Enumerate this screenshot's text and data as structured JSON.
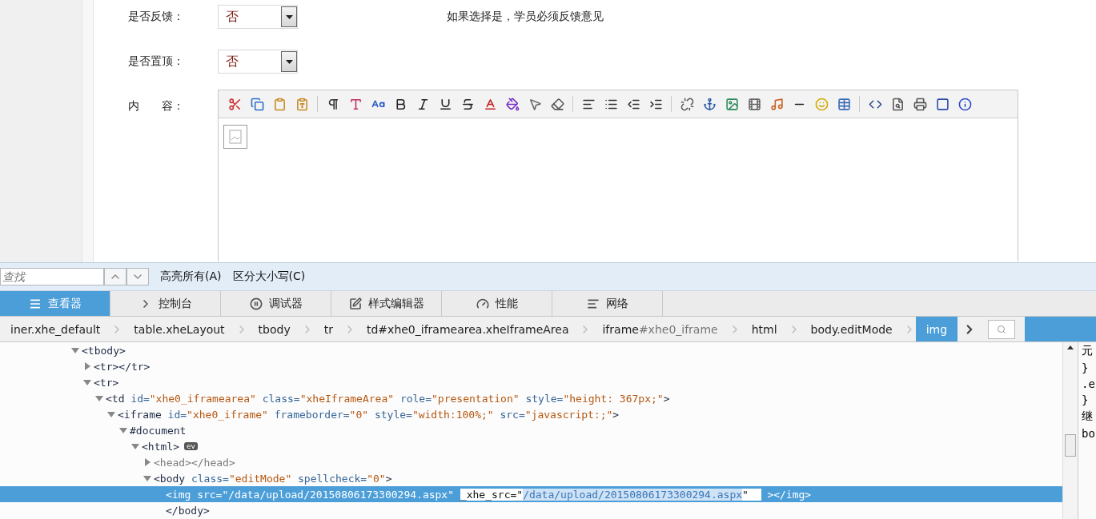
{
  "form": {
    "rows": [
      {
        "kind": "select",
        "label": "是否反馈：",
        "value": "否",
        "hint": "如果选择是，学员必须反馈意见"
      },
      {
        "kind": "select",
        "label": "是否置顶：",
        "value": "否"
      },
      {
        "kind": "editor",
        "label": "内　　容："
      }
    ]
  },
  "devtools": {
    "find_bar": {
      "placeholder": "查找",
      "options": [
        "高亮所有(A)",
        "区分大小写(C)"
      ]
    },
    "tabs": [
      {
        "label": "查看器",
        "selected": true
      },
      {
        "label": "控制台",
        "selected": false
      },
      {
        "label": "调试器",
        "selected": false
      },
      {
        "label": "样式编辑器",
        "selected": false
      },
      {
        "label": "性能",
        "selected": false
      },
      {
        "label": "网络",
        "selected": false
      }
    ],
    "breadcrumbs": [
      {
        "label": "iner.xhe_default",
        "selected": false
      },
      {
        "label": "table.xheLayout",
        "selected": false
      },
      {
        "label": "tbody",
        "selected": false
      },
      {
        "label": "tr",
        "selected": false
      },
      {
        "label": "td#xhe0_iframearea.xheIframeArea",
        "selected": false
      },
      {
        "label": "iframe",
        "suffix": "#xhe0_iframe",
        "selected": false
      },
      {
        "label": "html",
        "selected": false
      },
      {
        "label": "body.editMode",
        "selected": false
      },
      {
        "label": "img",
        "selected": true
      }
    ],
    "tree": [
      {
        "kind": "branch",
        "expanded": true,
        "selected": false,
        "tokens": [
          {
            "kind": "tag",
            "text": "<tbody>"
          }
        ],
        "children": [
          {
            "kind": "branch",
            "expanded": false,
            "selected": false,
            "tokens": [
              {
                "kind": "tag",
                "text": "<tr></tr>"
              }
            ]
          },
          {
            "kind": "branch",
            "expanded": true,
            "selected": false,
            "tokens": [
              {
                "kind": "tag",
                "text": "<tr>"
              }
            ],
            "children": [
              {
                "kind": "branch",
                "expanded": true,
                "selected": false,
                "tokens": [
                  {
                    "kind": "tag",
                    "text": "<td"
                  },
                  {
                    "kind": "attr",
                    "text": " id="
                  },
                  {
                    "kind": "value",
                    "text": "\"xhe0_iframearea\""
                  },
                  {
                    "kind": "attr",
                    "text": " class="
                  },
                  {
                    "kind": "value",
                    "text": "\"xheIframeArea\""
                  },
                  {
                    "kind": "attr",
                    "text": " role="
                  },
                  {
                    "kind": "value",
                    "text": "\"presentation\""
                  },
                  {
                    "kind": "attr",
                    "text": " style="
                  },
                  {
                    "kind": "value",
                    "text": "\"height: 367px;\""
                  },
                  {
                    "kind": "tag",
                    "text": ">"
                  }
                ],
                "children": [
                  {
                    "kind": "branch",
                    "expanded": true,
                    "selected": false,
                    "tokens": [
                      {
                        "kind": "tag",
                        "text": "<iframe"
                      },
                      {
                        "kind": "attr",
                        "text": " id="
                      },
                      {
                        "kind": "value",
                        "text": "\"xhe0_iframe\""
                      },
                      {
                        "kind": "attr",
                        "text": " frameborder="
                      },
                      {
                        "kind": "value",
                        "text": "\"0\""
                      },
                      {
                        "kind": "attr",
                        "text": " style="
                      },
                      {
                        "kind": "value",
                        "text": "\"width:100%;\""
                      },
                      {
                        "kind": "attr",
                        "text": " src="
                      },
                      {
                        "kind": "value",
                        "text": "\"javascript:;\""
                      },
                      {
                        "kind": "tag",
                        "text": ">"
                      }
                    ],
                    "children": [
                      {
                        "kind": "branch",
                        "expanded": true,
                        "selected": false,
                        "tokens": [
                          {
                            "kind": "tag",
                            "text": "#document"
                          }
                        ],
                        "children": [
                          {
                            "kind": "branch",
                            "expanded": true,
                            "selected": false,
                            "badge": "ev",
                            "tokens": [
                              {
                                "kind": "tag",
                                "text": "<html>"
                              }
                            ],
                            "children": [
                              {
                                "kind": "branch",
                                "expanded": false,
                                "selected": false,
                                "tokens": [
                                  {
                                    "kind": "muted",
                                    "text": "<head></head>"
                                  }
                                ]
                              },
                              {
                                "kind": "branch",
                                "expanded": true,
                                "selected": false,
                                "tokens": [
                                  {
                                    "kind": "tag",
                                    "text": "<body"
                                  },
                                  {
                                    "kind": "attr",
                                    "text": " class="
                                  },
                                  {
                                    "kind": "value",
                                    "text": "\"editMode\""
                                  },
                                  {
                                    "kind": "attr",
                                    "text": " spellcheck="
                                  },
                                  {
                                    "kind": "value",
                                    "text": "\"0\""
                                  },
                                  {
                                    "kind": "tag",
                                    "text": ">"
                                  }
                                ],
                                "children": [
                                  {
                                    "kind": "leaf",
                                    "selected": true,
                                    "tokens": [
                                      {
                                        "kind": "plain",
                                        "text": "<img src=\"/data/upload/20150806173300294.aspx\" "
                                      },
                                      {
                                        "kind": "edit",
                                        "text": "_xhe_src=\""
                                      },
                                      {
                                        "kind": "edit-selected",
                                        "text": "/data/upload/20150806173300294.aspx"
                                      },
                                      {
                                        "kind": "edit",
                                        "text": "\"  "
                                      },
                                      {
                                        "kind": "plain",
                                        "text": " ></img>"
                                      }
                                    ]
                                  },
                                  {
                                    "kind": "leaf",
                                    "selected": false,
                                    "tokens": [
                                      {
                                        "kind": "tag",
                                        "text": "</body>"
                                      }
                                    ]
                                  }
                                ]
                              }
                            ]
                          }
                        ]
                      }
                    ]
                  }
                ]
              }
            ]
          }
        ]
      }
    ],
    "side_panel": [
      "元",
      "}",
      ".e",
      "}",
      "继",
      "bo"
    ]
  }
}
